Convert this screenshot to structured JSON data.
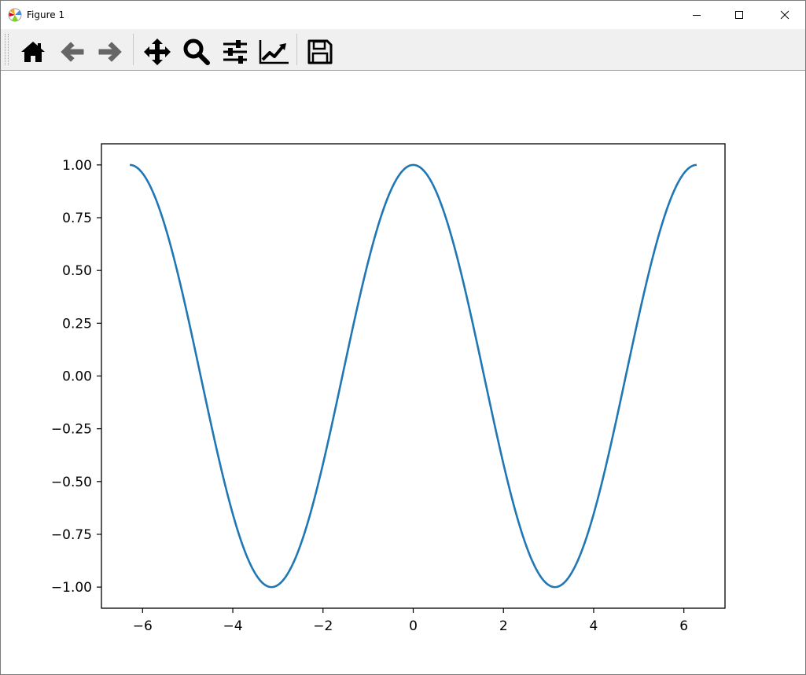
{
  "window": {
    "title": "Figure 1",
    "icons": {
      "app": "matplotlib-logo-icon",
      "minimize": "minimize-icon",
      "maximize": "maximize-icon",
      "close": "close-icon"
    }
  },
  "toolbar": {
    "items": [
      {
        "name": "home-icon",
        "action": "Reset original view"
      },
      {
        "name": "back-arrow-icon",
        "action": "Back to previous view"
      },
      {
        "name": "forward-arrow-icon",
        "action": "Forward to next view"
      },
      {
        "name": "pan-move-icon",
        "action": "Pan axes"
      },
      {
        "name": "zoom-magnifier-icon",
        "action": "Zoom to rectangle"
      },
      {
        "name": "subplots-sliders-icon",
        "action": "Configure subplots"
      },
      {
        "name": "edit-axes-chart-icon",
        "action": "Edit axis, curve and image parameters"
      },
      {
        "name": "save-floppy-icon",
        "action": "Save the figure"
      }
    ]
  },
  "chart_data": {
    "type": "line",
    "title": "",
    "xlabel": "",
    "ylabel": "",
    "xlim": [
      -6.912,
      6.912
    ],
    "ylim": [
      -1.1,
      1.1
    ],
    "x_ticks": [
      -6,
      -4,
      -2,
      0,
      2,
      4,
      6
    ],
    "x_tick_labels": [
      "−6",
      "−4",
      "−2",
      "0",
      "2",
      "4",
      "6"
    ],
    "y_ticks": [
      1.0,
      0.75,
      0.5,
      0.25,
      0.0,
      -0.25,
      -0.5,
      -0.75,
      -1.0
    ],
    "y_tick_labels": [
      "1.00",
      "0.75",
      "0.50",
      "0.25",
      "0.00",
      "−0.25",
      "−0.50",
      "−0.75",
      "−1.00"
    ],
    "grid": false,
    "legend": "none",
    "series": [
      {
        "color": "#1f77b4",
        "x": [
          -6.283,
          -6.0,
          -5.5,
          -5.0,
          -4.712,
          -4.5,
          -4.0,
          -3.5,
          -3.142,
          -3.0,
          -2.5,
          -2.0,
          -1.571,
          -1.5,
          -1.0,
          -0.5,
          0.0,
          0.5,
          1.0,
          1.5,
          1.571,
          2.0,
          2.5,
          3.0,
          3.142,
          3.5,
          4.0,
          4.5,
          4.712,
          5.0,
          5.5,
          6.0,
          6.283
        ],
        "y": [
          1.0,
          0.96,
          0.709,
          0.284,
          0.0,
          -0.211,
          -0.654,
          -0.936,
          -1.0,
          -0.99,
          -0.801,
          -0.416,
          0.0,
          0.071,
          0.54,
          0.878,
          1.0,
          0.878,
          0.54,
          0.071,
          0.0,
          -0.416,
          -0.801,
          -0.99,
          -1.0,
          -0.936,
          -0.654,
          -0.211,
          0.0,
          0.284,
          0.709,
          0.96,
          1.0
        ]
      }
    ]
  }
}
